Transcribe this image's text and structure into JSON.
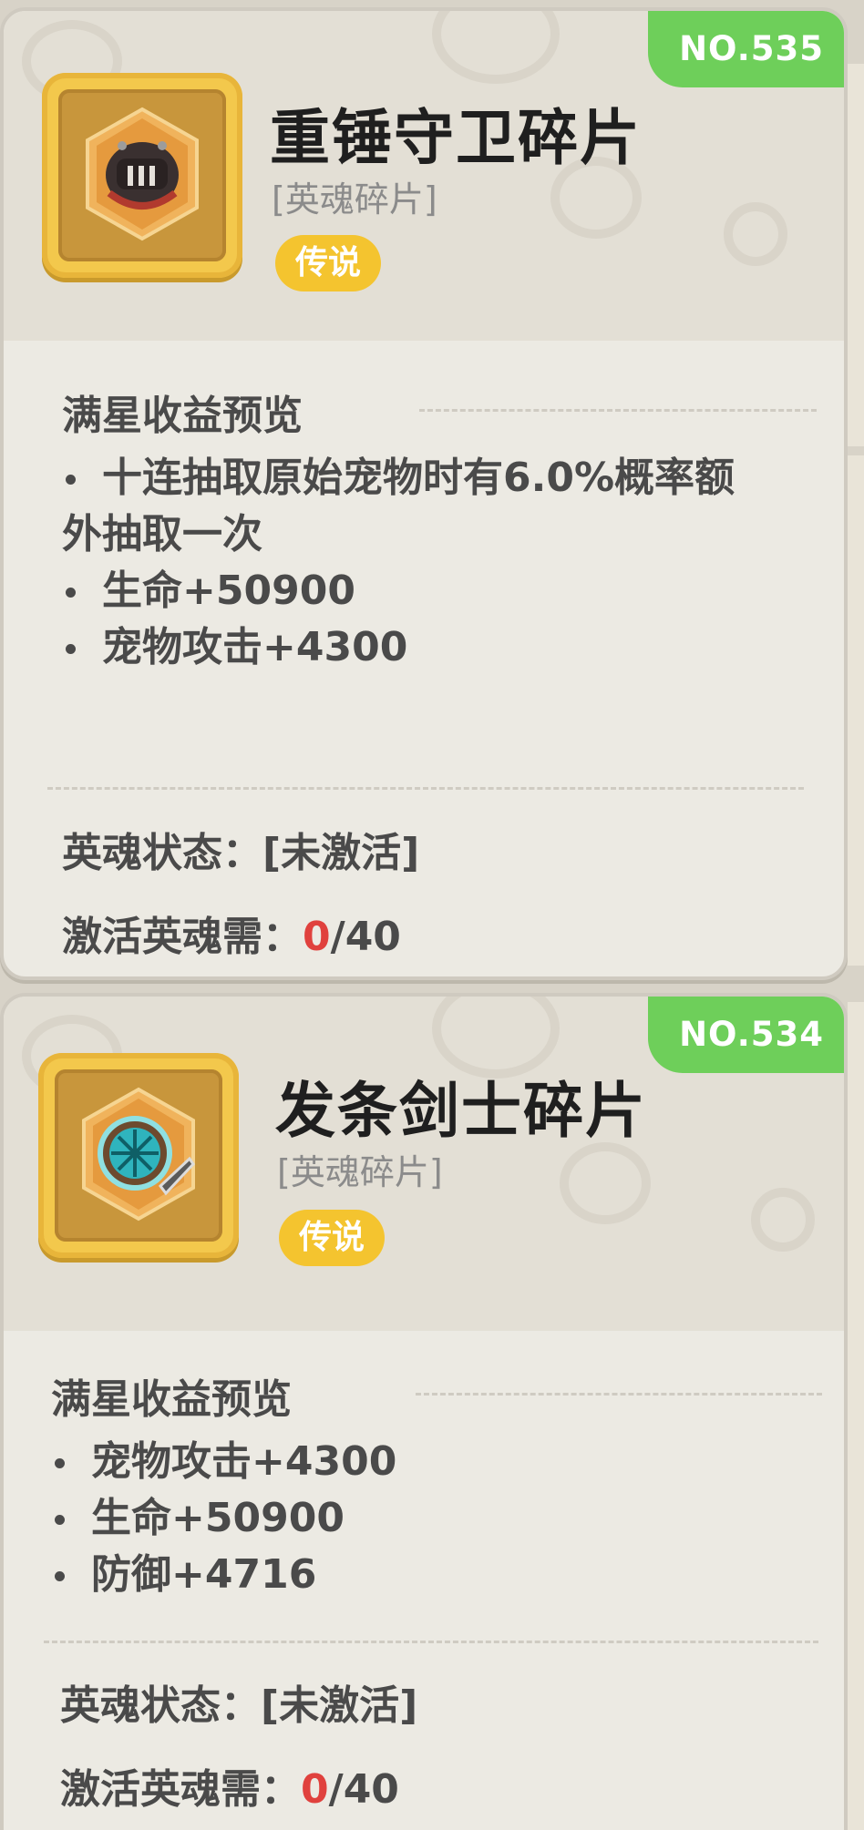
{
  "cards": [
    {
      "number": "NO.535",
      "name": "重锤守卫碎片",
      "category": "[英魂碎片]",
      "rarity": "传说",
      "section_title": "满星收益预览",
      "bonus_first": "十连抽取原始宠物时有6.0%概率额",
      "bonus_first_cont": "外抽取一次",
      "bonuses": [
        "生命+50900",
        "宠物攻击+4300"
      ],
      "status_label": "英魂状态：",
      "status_value": "[未激活]",
      "require_label": "激活英魂需：",
      "require_current": "0",
      "require_total": "/40",
      "icon": "hammer-guard-helmet-icon"
    },
    {
      "number": "NO.534",
      "name": "发条剑士碎片",
      "category": "[英魂碎片]",
      "rarity": "传说",
      "section_title": "满星收益预览",
      "bonuses": [
        "宠物攻击+4300",
        "生命+50900",
        "防御+4716"
      ],
      "status_label": "英魂状态：",
      "status_value": "[未激活]",
      "require_label": "激活英魂需：",
      "require_current": "0",
      "require_total": "/40",
      "icon": "clockwork-swordsman-helmet-icon"
    }
  ],
  "colors": {
    "badge_green": "#6ecf5a",
    "rarity_gold": "#f4c42f",
    "count_red": "#e0413d",
    "card_bg": "#eceae3"
  }
}
